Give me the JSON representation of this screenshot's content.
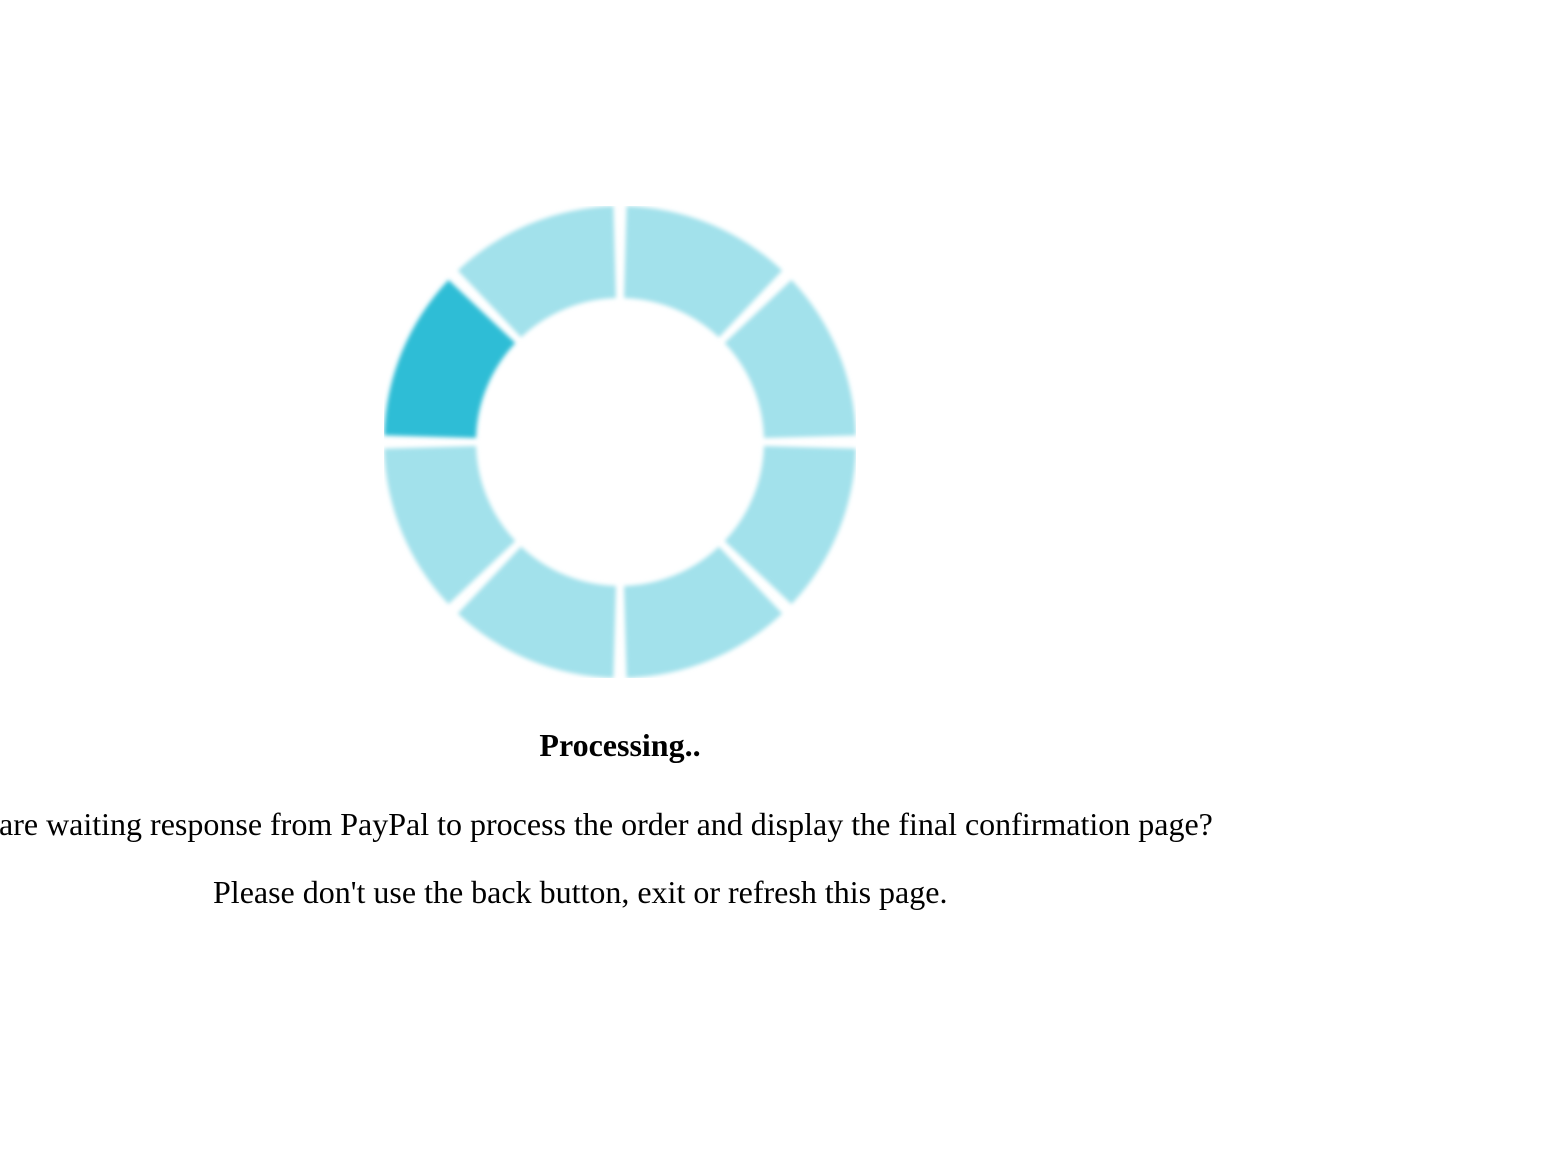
{
  "spinner": {
    "icon": "loading-spinner-icon",
    "segment_count": 8,
    "active_segment_index": 6,
    "inactive_color": "#a2e1eb",
    "active_color": "#2fbdd6"
  },
  "status": {
    "title": "Processing..",
    "message_line_1": "are waiting response from PayPal to process the order and display the final confirmation page?",
    "message_line_2": "Please don't use the back button, exit or refresh this page."
  }
}
